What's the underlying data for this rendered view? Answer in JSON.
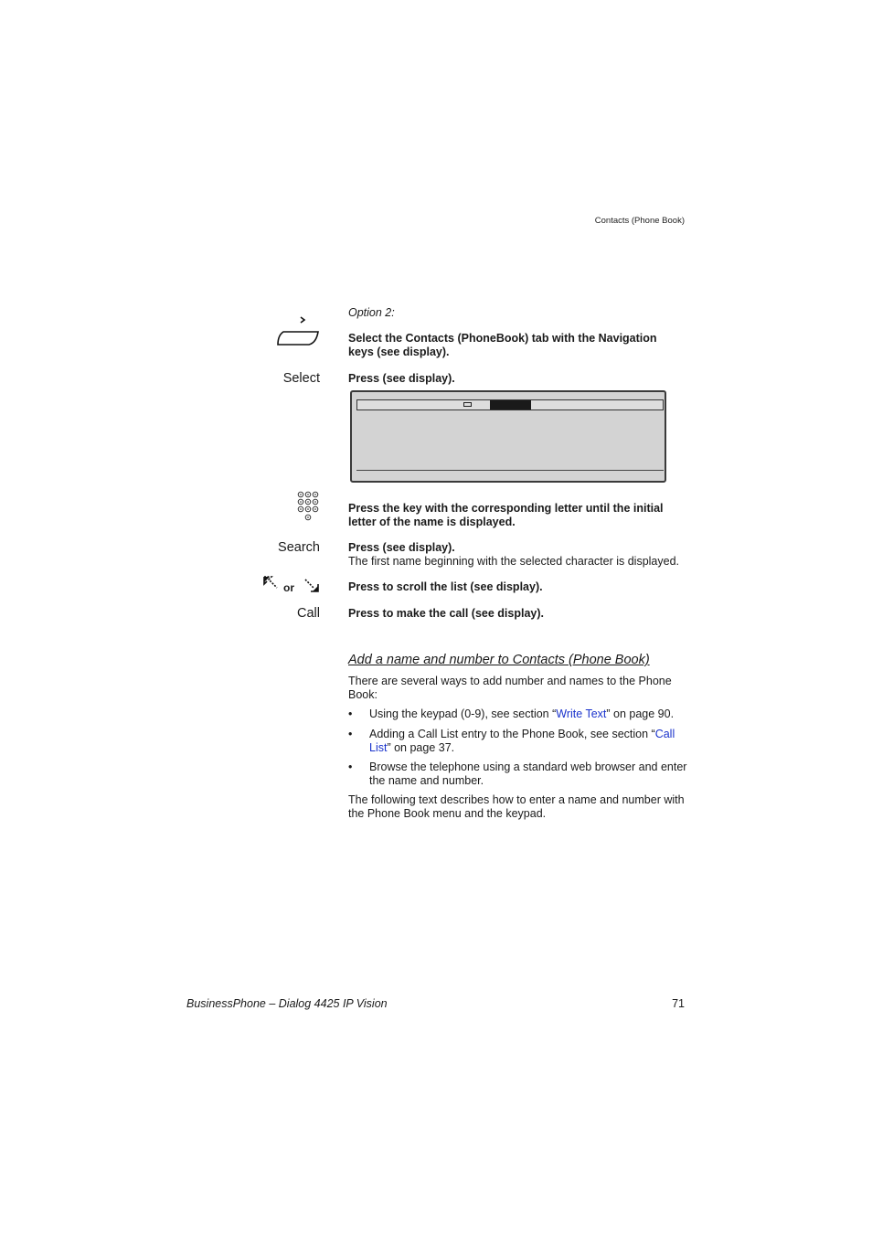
{
  "header": {
    "chapter": "Contacts (Phone Book)"
  },
  "steps": {
    "option_label": "Option 2:",
    "select_tab_text": "Select the Contacts (PhoneBook) tab with the Navigation keys (see display).",
    "select_key": "Select",
    "select_text": "Press (see display).",
    "keypad_text": "Press the key with the corresponding letter until the initial letter of the name is displayed.",
    "search_key": "Search",
    "search_text": "Press (see display).",
    "search_note": "The first name beginning with the selected character is displayed.",
    "scroll_or": "or",
    "scroll_text": "Press to scroll the list (see display).",
    "call_key": "Call",
    "call_text": "Press to make the call (see display)."
  },
  "section": {
    "heading": "Add a name and number to Contacts (Phone Book)",
    "intro": "There are several ways to add number and names to the Phone Book:",
    "bullets": [
      {
        "before": "Using the keypad (0-9), see section “",
        "link": "Write Text",
        "after": "” on page 90."
      },
      {
        "before": "Adding a Call List entry to the Phone Book, see section “",
        "link": "Call List",
        "after": "” on page 37."
      },
      {
        "before": "Browse the telephone using a standard web browser and enter the name and number.",
        "link": "",
        "after": ""
      }
    ],
    "outro": "The following text describes how to enter a name and number with the Phone Book menu and the keypad."
  },
  "footer": {
    "title": "BusinessPhone – Dialog 4425 IP Vision",
    "page_number": "71"
  },
  "colors": {
    "link": "#1a33cc",
    "display_bg": "#d3d3d3"
  }
}
